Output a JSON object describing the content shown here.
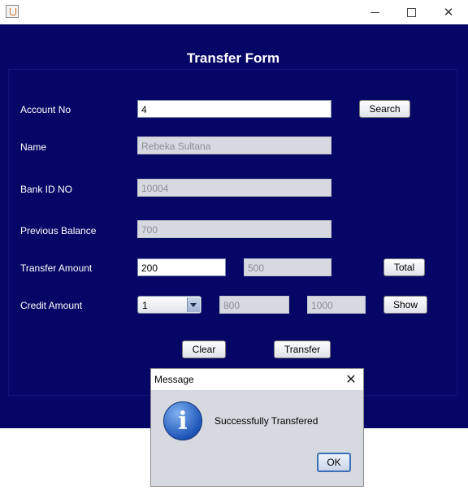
{
  "window": {
    "title": "",
    "min_icon": "minimize-icon",
    "max_icon": "maximize-icon",
    "close_icon": "close-icon"
  },
  "form": {
    "title": "Transfer Form",
    "account_label": "Account No",
    "account_value": "4",
    "search_button": "Search",
    "name_label": "Name",
    "name_value": "Rebeka Sultana",
    "bank_id_label": "Bank ID NO",
    "bank_id_value": "10004",
    "prev_balance_label": "Previous Balance",
    "prev_balance_value": "700",
    "transfer_label": "Transfer Amount",
    "transfer_value": "200",
    "transfer_total_value": "500",
    "total_button": "Total",
    "credit_label": "Credit Amount",
    "credit_select": "1",
    "credit_value1": "800",
    "credit_value2": "1000",
    "show_button": "Show",
    "clear_button": "Clear",
    "transfer_button": "Transfer"
  },
  "dialog": {
    "title": "Message",
    "close_glyph": "✕",
    "icon_glyph": "i",
    "message": "Successfully Transfered",
    "ok_button": "OK"
  },
  "colors": {
    "background": "#060666",
    "dialog_bg": "#d6d9df",
    "accent": "#3b6fb6"
  }
}
